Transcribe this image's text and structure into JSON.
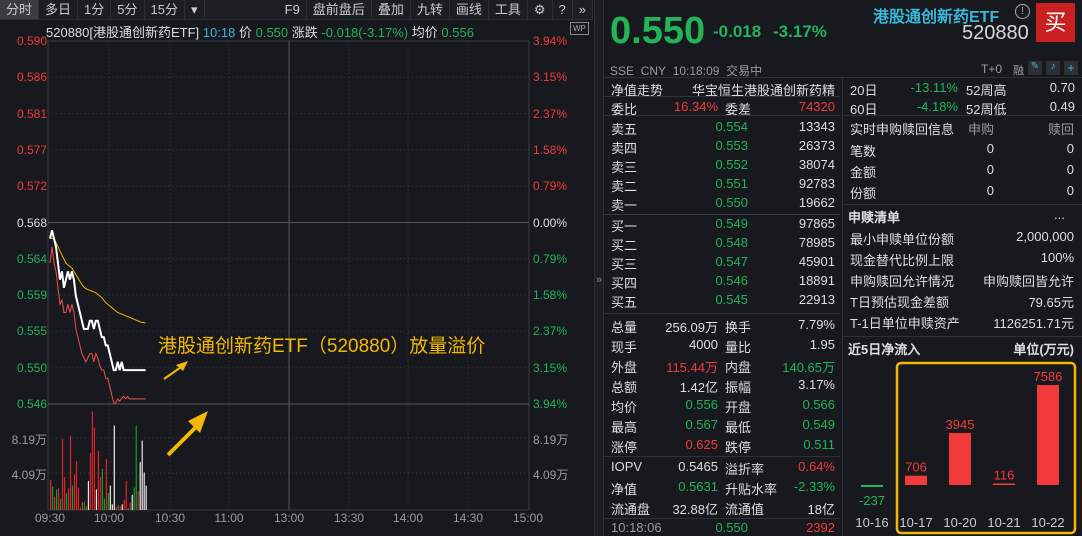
{
  "toolbar": {
    "tabs": [
      "分时",
      "多日",
      "1分",
      "5分",
      "15分"
    ],
    "dropdown": "▾",
    "right": [
      "F9",
      "盘前盘后",
      "叠加",
      "九转",
      "画线",
      "工具"
    ],
    "gear": "⚙",
    "help": "?",
    "more": "»"
  },
  "info": {
    "name": "520880[港股通创新药ETF]",
    "time": "10:18",
    "price_label": "价",
    "price": "0.550",
    "chg_label": "涨跌",
    "chg": "-0.018(-3.17%)",
    "avg_label": "均价",
    "avg": "0.556",
    "wp": "WP"
  },
  "axis": {
    "left": [
      "0.590",
      "0.586",
      "0.581",
      "0.577",
      "0.572",
      "0.568",
      "0.564",
      "0.559",
      "0.555",
      "0.550",
      "0.546"
    ],
    "right": [
      "3.94%",
      "3.15%",
      "2.37%",
      "1.58%",
      "0.79%",
      "0.00%",
      "0.79%",
      "1.58%",
      "2.37%",
      "3.15%",
      "3.94%"
    ],
    "vol": [
      "8.19万",
      "4.09万"
    ],
    "time": [
      "09:30",
      "10:00",
      "10:30",
      "11:00",
      "13:00",
      "13:30",
      "14:00",
      "14:30",
      "15:00"
    ]
  },
  "annotation": "港股通创新药ETF（520880）放量溢价",
  "chart_data": {
    "type": "line",
    "title": "分时",
    "x_start": "09:30",
    "ylim": [
      0.546,
      0.59
    ],
    "base": 0.568,
    "price": [
      0.566,
      0.567,
      0.566,
      0.565,
      0.563,
      0.561,
      0.562,
      0.56,
      0.561,
      0.562,
      0.561,
      0.562,
      0.561,
      0.559,
      0.558,
      0.557,
      0.556,
      0.555,
      0.555,
      0.555,
      0.556,
      0.556,
      0.555,
      0.556,
      0.556,
      0.555,
      0.554,
      0.554,
      0.553,
      0.553,
      0.552,
      0.551,
      0.55,
      0.55,
      0.551,
      0.55,
      0.551,
      0.55,
      0.55,
      0.55,
      0.55,
      0.55,
      0.55,
      0.55,
      0.55,
      0.55,
      0.55,
      0.55,
      0.55
    ],
    "avg": [
      0.566,
      0.566,
      0.566,
      0.5655,
      0.565,
      0.5645,
      0.564,
      0.5635,
      0.563,
      0.5628,
      0.5626,
      0.5624,
      0.562,
      0.5616,
      0.5612,
      0.5608,
      0.5604,
      0.5601,
      0.5599,
      0.5598,
      0.5597,
      0.5596,
      0.5595,
      0.5594,
      0.5592,
      0.559,
      0.5588,
      0.5585,
      0.5582,
      0.558,
      0.5578,
      0.5576,
      0.5574,
      0.5572,
      0.557,
      0.5569,
      0.5568,
      0.5567,
      0.5566,
      0.5565,
      0.5564,
      0.5563,
      0.5562,
      0.5561,
      0.556,
      0.5559,
      0.5558,
      0.5558,
      0.5557
    ],
    "iopv": [
      0.563,
      0.565,
      0.563,
      0.562,
      0.56,
      0.558,
      0.5585,
      0.557,
      0.557,
      0.558,
      0.557,
      0.558,
      0.557,
      0.555,
      0.554,
      0.553,
      0.552,
      0.5515,
      0.551,
      0.5515,
      0.552,
      0.552,
      0.551,
      0.552,
      0.5515,
      0.5505,
      0.55,
      0.55,
      0.549,
      0.549,
      0.548,
      0.547,
      0.546,
      0.546,
      0.5465,
      0.5462,
      0.5466,
      0.5468,
      0.5465,
      0.5468,
      0.5465,
      0.5465,
      0.5465,
      0.5465,
      0.5465,
      0.5465,
      0.5465,
      0.5465,
      0.5465
    ],
    "volume_wan": [
      3.2,
      2.5,
      1.4,
      2.2,
      2.3,
      1.2,
      7.6,
      3.5,
      1.8,
      2.3,
      7.9,
      2.6,
      3.8,
      5.2,
      2.4,
      0.3,
      0.8,
      0.9,
      0.4,
      3.1,
      6.1,
      10.5,
      8.8,
      2.2,
      6.3,
      3.5,
      4.4,
      1.2,
      5.4,
      1.8,
      2.6,
      0.6,
      9.0,
      0.3,
      0.5,
      0.4,
      0.6,
      1.1,
      3.1,
      0.2,
      0.8,
      1.6,
      2.4,
      9.0,
      2.0,
      5.1,
      7.4,
      4.0,
      2.6
    ],
    "volume_dir": [
      "up",
      "down",
      "up",
      "down",
      "up",
      "down",
      "up",
      "up",
      "down",
      "up",
      "up",
      "down",
      "up",
      "up",
      "up",
      "up",
      "down",
      "up",
      "down",
      "flat",
      "up",
      "up",
      "up",
      "flat",
      "up",
      "up",
      "down",
      "down",
      "up",
      "down",
      "flat",
      "flat",
      "flat",
      "up",
      "down",
      "up",
      "flat",
      "up",
      "up",
      "down",
      "up",
      "flat",
      "down",
      "down",
      "up",
      "flat",
      "flat",
      "flat",
      "flat"
    ]
  },
  "quote": {
    "price": "0.550",
    "chg": "-0.018",
    "pct": "-3.17%",
    "name": "港股通创新药ETF",
    "info": "!",
    "code": "520880",
    "buy": "买",
    "exch": "SSE",
    "cur": "CNY",
    "time": "10:18:09",
    "status": "交易中",
    "t0": "T+0",
    "rong": "融"
  },
  "nav": {
    "label": "净值走势",
    "index": "华宝恒生港股通创新药精",
    "wb_label": "委比",
    "wb": "16.34%",
    "wc_label": "委差",
    "wc": "74320"
  },
  "perf": [
    {
      "l": "20日",
      "v": "-13.11%",
      "k": "52周高",
      "x": "0.70"
    },
    {
      "l": "60日",
      "v": "-4.18%",
      "k": "52周低",
      "x": "0.49"
    }
  ],
  "asks": [
    {
      "l": "卖五",
      "p": "0.554",
      "v": "13343"
    },
    {
      "l": "卖四",
      "p": "0.553",
      "v": "26373"
    },
    {
      "l": "卖三",
      "p": "0.552",
      "v": "38074"
    },
    {
      "l": "卖二",
      "p": "0.551",
      "v": "92783"
    },
    {
      "l": "卖一",
      "p": "0.550",
      "v": "19662"
    }
  ],
  "bids": [
    {
      "l": "买一",
      "p": "0.549",
      "v": "97865"
    },
    {
      "l": "买二",
      "p": "0.548",
      "v": "78985"
    },
    {
      "l": "买三",
      "p": "0.547",
      "v": "45901"
    },
    {
      "l": "买四",
      "p": "0.546",
      "v": "18891"
    },
    {
      "l": "买五",
      "p": "0.545",
      "v": "22913"
    }
  ],
  "stats": [
    [
      "总量",
      "256.09万",
      "w",
      "换手",
      "7.79%",
      "w"
    ],
    [
      "现手",
      "4000",
      "w",
      "量比",
      "1.95",
      "w"
    ],
    [
      "外盘",
      "115.44万",
      "r",
      "内盘",
      "140.65万",
      "g"
    ],
    [
      "总额",
      "1.42亿",
      "w",
      "振幅",
      "3.17%",
      "w"
    ],
    [
      "均价",
      "0.556",
      "g",
      "开盘",
      "0.566",
      "g"
    ],
    [
      "最高",
      "0.567",
      "g",
      "最低",
      "0.549",
      "g"
    ],
    [
      "涨停",
      "0.625",
      "r",
      "跌停",
      "0.511",
      "g"
    ]
  ],
  "etf": [
    [
      "IOPV",
      "0.5465",
      "w",
      "溢折率",
      "0.64%",
      "r"
    ],
    [
      "净值",
      "0.5631",
      "g",
      "升贴水率",
      "-2.33%",
      "g"
    ],
    [
      "流通盘",
      "32.88亿",
      "w",
      "流通值",
      "18亿",
      "w"
    ]
  ],
  "tick": {
    "time": "10:18:06",
    "price": "0.550",
    "vol": "2392"
  },
  "sub": {
    "title": "实时申购赎回信息",
    "c1": "申购",
    "c2": "赎回",
    "rows": [
      [
        "笔数",
        "0",
        "0"
      ],
      [
        "金额",
        "0",
        "0"
      ],
      [
        "份额",
        "0",
        "0"
      ]
    ]
  },
  "list": {
    "title": "申赎清单",
    "more": "...",
    "rows": [
      [
        "最小申赎单位份额",
        "2,000,000"
      ],
      [
        "现金替代比例上限",
        "100%"
      ],
      [
        "申购赎回允许情况",
        "申购赎回皆允许"
      ],
      [
        "T日预估现金差额",
        "79.65元"
      ],
      [
        "T-1日单位申赎资产",
        "1126251.71元"
      ]
    ]
  },
  "flow": {
    "title": "近5日净流入",
    "unit": "单位(万元)",
    "dates": [
      "10-16",
      "10-17",
      "10-20",
      "10-21",
      "10-22"
    ],
    "values": [
      -237,
      706,
      3945,
      116,
      7586
    ],
    "labels": [
      "-237",
      "706",
      "3945",
      "116",
      "7586"
    ]
  },
  "colors": {
    "up": "#f23a3a",
    "down": "#21b458",
    "highlight": "#f5b800"
  }
}
